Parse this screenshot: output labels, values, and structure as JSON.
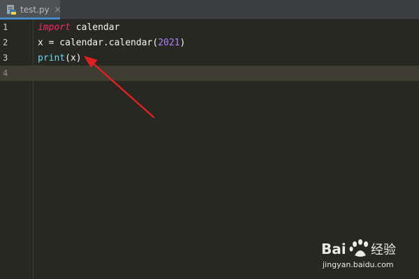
{
  "tab": {
    "label": "test.py",
    "close_glyph": "✕",
    "icon": "python-file-icon",
    "accent": "#4a88c7"
  },
  "editor": {
    "lines": [
      {
        "number": "1",
        "tokens": [
          {
            "text": "import",
            "kind": "keyword"
          },
          {
            "text": " calendar",
            "kind": "plain"
          }
        ]
      },
      {
        "number": "2",
        "tokens": [
          {
            "text": "x = calendar.",
            "kind": "plain"
          },
          {
            "text": "calendar",
            "kind": "plain"
          },
          {
            "text": "(",
            "kind": "plain"
          },
          {
            "text": "2021",
            "kind": "number"
          },
          {
            "text": ")",
            "kind": "plain"
          }
        ]
      },
      {
        "number": "3",
        "tokens": [
          {
            "text": "print",
            "kind": "builtin"
          },
          {
            "text": "(x)",
            "kind": "plain"
          }
        ]
      },
      {
        "number": "4",
        "tokens": []
      }
    ],
    "current_line": 4,
    "colors": {
      "background": "#272822",
      "keyword": "#f92672",
      "builtin": "#66d9ef",
      "number": "#ae81ff",
      "plain": "#f8f8f2"
    }
  },
  "annotation": {
    "color": "#e02020",
    "icon": "red-arrow-pointer"
  },
  "watermark": {
    "url": "jingyan.baidu.com",
    "logo": "baidu-jingyan-logo"
  }
}
